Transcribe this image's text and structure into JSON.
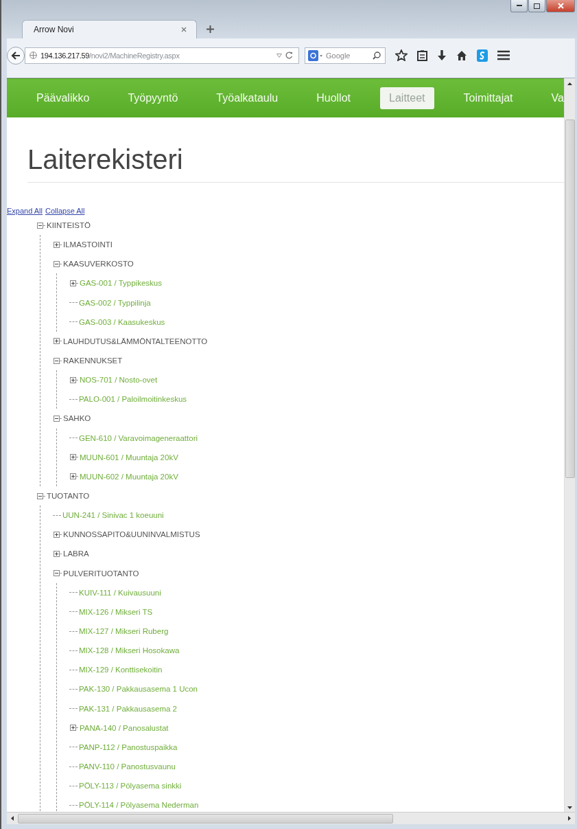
{
  "browser": {
    "tab_title": "Arrow Novi",
    "url_host": "194.136.217.59",
    "url_path": "/novi2/MachineRegistry.aspx",
    "search_placeholder": "Google"
  },
  "nav": [
    {
      "label": "Päävalikko",
      "selected": false
    },
    {
      "label": "Työpyyntö",
      "selected": false
    },
    {
      "label": "Työalkataulu",
      "selected": false
    },
    {
      "label": "Huollot",
      "selected": false
    },
    {
      "label": "Laitteet",
      "selected": true
    },
    {
      "label": "Toimittajat",
      "selected": false
    },
    {
      "label": "Va",
      "selected": false
    }
  ],
  "page_title": "Laiterekisteri",
  "tree_links": [
    "Expand All",
    "Collapse All"
  ],
  "tree": [
    {
      "label": "KIINTEISTÖ",
      "kind": "group",
      "expanded": true,
      "children": [
        {
          "label": "ILMASTOINTI",
          "kind": "group",
          "expanded": false
        },
        {
          "label": "KAASUVERKOSTO",
          "kind": "group",
          "expanded": true,
          "children": [
            {
              "label": "GAS-001 / Typpikeskus",
              "kind": "device",
              "expanded": false
            },
            {
              "label": "GAS-002 / Typpilinja",
              "kind": "device"
            },
            {
              "label": "GAS-003 / Kaasukeskus",
              "kind": "device"
            }
          ]
        },
        {
          "label": "LAUHDUTUS&LÄMMÖNTALTEENOTTO",
          "kind": "group",
          "expanded": false
        },
        {
          "label": "RAKENNUKSET",
          "kind": "group",
          "expanded": true,
          "children": [
            {
              "label": "NOS-701 / Nosto-ovet",
              "kind": "device",
              "expanded": false
            },
            {
              "label": "PALO-001 / Paloilmoitinkeskus",
              "kind": "device"
            }
          ]
        },
        {
          "label": "SAHKO",
          "kind": "group",
          "expanded": true,
          "children": [
            {
              "label": "GEN-610 / Varavoimageneraattori",
              "kind": "device"
            },
            {
              "label": "MUUN-601 / Muuntaja 20kV",
              "kind": "device",
              "expanded": false
            },
            {
              "label": "MUUN-602 / Muuntaja 20kV",
              "kind": "device",
              "expanded": false
            }
          ]
        }
      ]
    },
    {
      "label": "TUOTANTO",
      "kind": "group",
      "expanded": true,
      "children": [
        {
          "label": "UUN-241 / Sinivac 1 koeuuni",
          "kind": "device"
        },
        {
          "label": "KUNNOSSAPITO&UUNINVALMISTUS",
          "kind": "group",
          "expanded": false
        },
        {
          "label": "LABRA",
          "kind": "group",
          "expanded": false
        },
        {
          "label": "PULVERITUOTANTO",
          "kind": "group",
          "expanded": true,
          "children": [
            {
              "label": "KUIV-111 / Kuivausuuni",
              "kind": "device"
            },
            {
              "label": "MIX-126 / Mikseri TS",
              "kind": "device"
            },
            {
              "label": "MIX-127 / Mikseri Ruberg",
              "kind": "device"
            },
            {
              "label": "MIX-128 / Mikseri Hosokawa",
              "kind": "device"
            },
            {
              "label": "MIX-129 / Konttisekoitin",
              "kind": "device"
            },
            {
              "label": "PAK-130 / Pakkausasema 1 Ucon",
              "kind": "device"
            },
            {
              "label": "PAK-131 / Pakkausasema 2",
              "kind": "device"
            },
            {
              "label": "PANA-140 / Panosalustat",
              "kind": "device",
              "expanded": false
            },
            {
              "label": "PANP-112 / Panostuspaikka",
              "kind": "device"
            },
            {
              "label": "PANV-110 / Panostusvaunu",
              "kind": "device"
            },
            {
              "label": "PÖLY-113 / Pölyasema sinkki",
              "kind": "device"
            },
            {
              "label": "PÖLY-114 / Pölyasema Nederman",
              "kind": "device"
            }
          ]
        }
      ]
    }
  ]
}
